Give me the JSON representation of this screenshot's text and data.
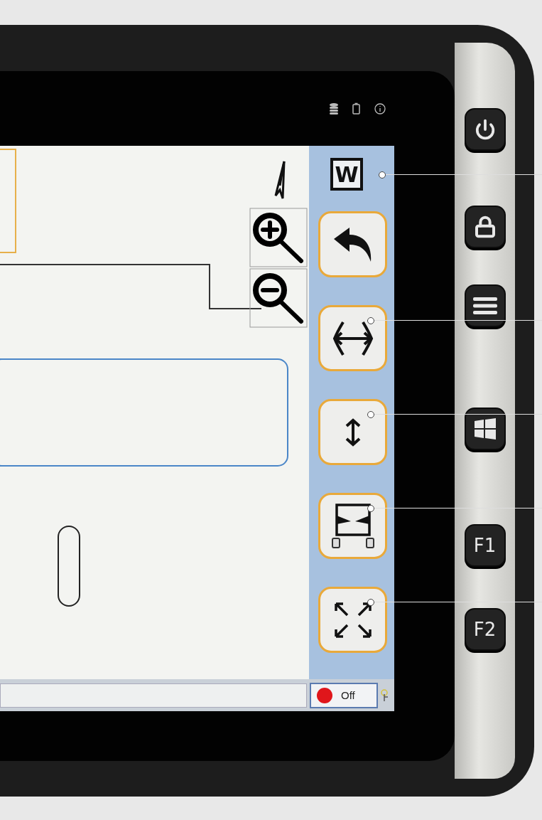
{
  "sidebar": {
    "logo": {
      "text": "W",
      "callout": true
    },
    "tools": [
      {
        "kind": "undo",
        "callout": false
      },
      {
        "kind": "stretch-horizontal",
        "callout": true
      },
      {
        "kind": "stretch-vertical",
        "callout": true
      },
      {
        "kind": "tilt",
        "callout": true
      },
      {
        "kind": "fullscreen",
        "callout": true
      }
    ]
  },
  "bottom_bar": {
    "record_button": {
      "label": "Off"
    }
  },
  "hardware_keys": [
    {
      "kind": "power"
    },
    {
      "kind": "lock"
    },
    {
      "kind": "menu"
    },
    {
      "kind": "windows"
    },
    {
      "kind": "function",
      "label": "F1"
    },
    {
      "kind": "function",
      "label": "F2"
    }
  ]
}
